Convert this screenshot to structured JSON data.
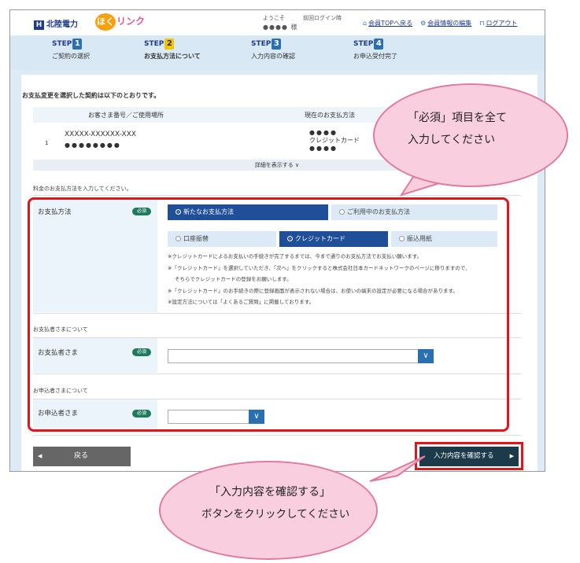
{
  "header": {
    "brand": "北陸電力",
    "brand_mark": "H",
    "service_first": "ほく",
    "service_rest": "リンク",
    "welcome": "ようこそ",
    "user_name": "●●●● 様",
    "last_login": "前回ログイン時",
    "links": [
      "会員TOPへ戻る",
      "会員情報の編集",
      "ログアウト"
    ]
  },
  "steps": [
    {
      "num": "1",
      "label": "ご契約の選択"
    },
    {
      "num": "2",
      "label": "お支払方法について"
    },
    {
      "num": "3",
      "label": "入力内容の確認"
    },
    {
      "num": "4",
      "label": "お申込受付完了"
    }
  ],
  "step_prefix": "STEP",
  "contract": {
    "intro": "お支払変更を選択した契約は以下のとおりです。",
    "col_customer": "お客さま番号／ご使用場所",
    "col_payment": "現在のお支払方法",
    "row_no": "1",
    "customer_no": "XXXXX-XXXXXX-XXX",
    "place": "●●●●●●●●",
    "payment_top": "●●●●",
    "payment_method": "クレジットカード",
    "payment_bottom": "●●●●",
    "detail": "詳細を表示する ∨"
  },
  "form": {
    "instruction": "料金のお支払方法を入力してください。",
    "required": "必須",
    "payment_label": "お支払方法",
    "opt_new": "新たなお支払方法",
    "opt_current": "ご利用中のお支払方法",
    "opt_bank": "口座振替",
    "opt_credit": "クレジットカード",
    "opt_slip": "振込用紙",
    "notes": [
      "※クレジットカードによるお支払いの手続きが完了するまでは、今まで通りのお支払方法でお支払い願います。",
      "※「クレジットカード」を選択していただき、「次へ」をクリックすると株式会社日本カードネットワークのページに移りますので、",
      "そちらでクレジットカードの登録をお願いします。",
      "※「クレジットカード」のお手続きの際に登録画面が表示されない場合は、お使いの端末の設定が必要になる場合があります。",
      "※設定方法については「よくあるご質問」に掲載しております。"
    ],
    "payer_section": "お支払者さまについて",
    "payer_label": "お支払者さま",
    "applicant_section": "お申込者さまについて",
    "applicant_label": "お申込者さま"
  },
  "buttons": {
    "back": "戻る",
    "confirm": "入力内容を確認する"
  },
  "callouts": {
    "top_line1": "「必須」項目を全て",
    "top_line2": "入力してください",
    "bottom_line1": "「入力内容を確認する」",
    "bottom_line2": "ボタンをクリックしてください"
  },
  "colors": {
    "highlight": "#e4141b",
    "primary": "#1f4f99",
    "bubble": "#f9cfe0"
  }
}
